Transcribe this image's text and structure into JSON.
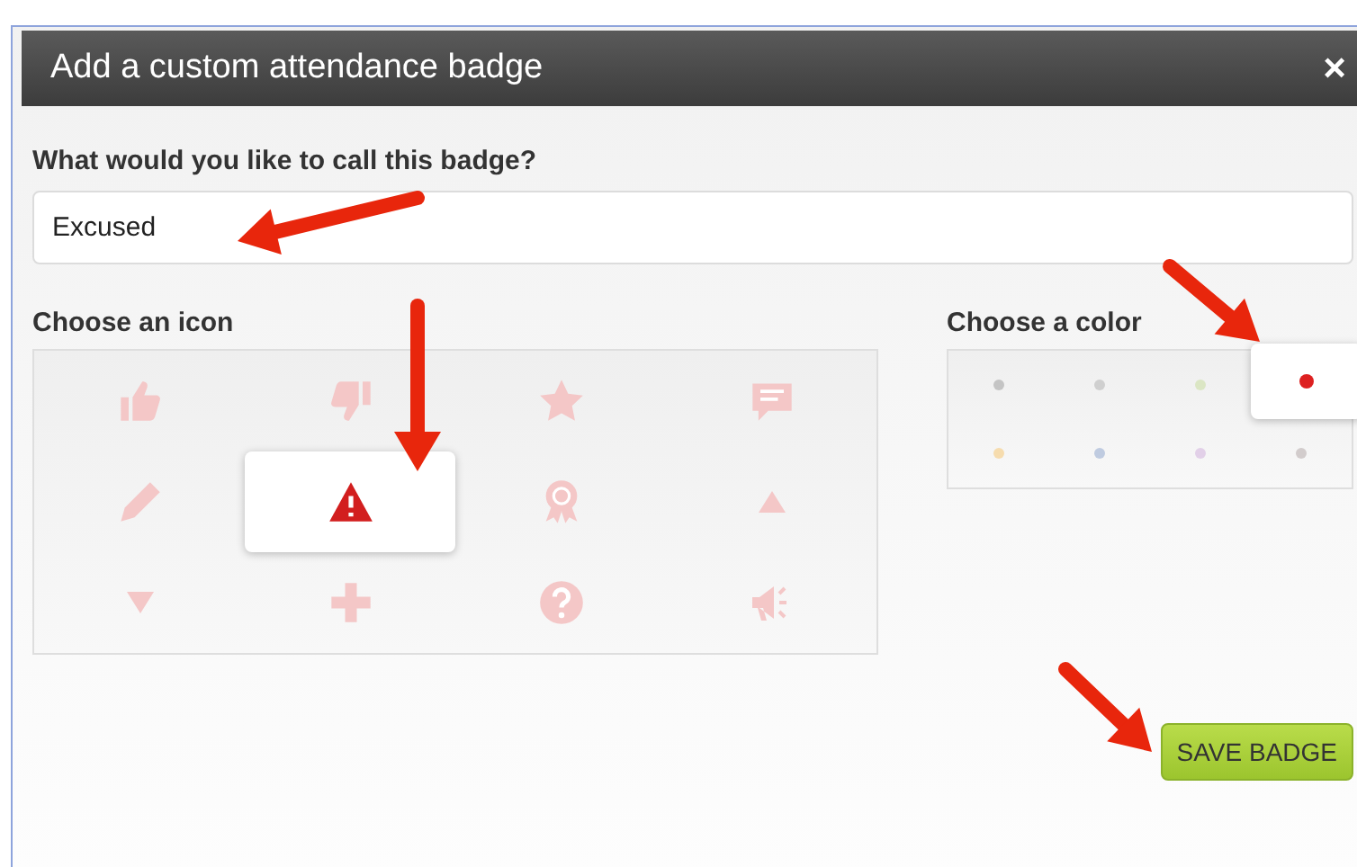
{
  "dialog": {
    "title": "Add a custom attendance badge",
    "close": "×"
  },
  "name_field": {
    "label": "What would you like to call this badge?",
    "value": "Excused"
  },
  "icon_picker": {
    "label": "Choose an icon",
    "icons": [
      {
        "kind": "thumbs-up",
        "selected": false
      },
      {
        "kind": "thumbs-down",
        "selected": false
      },
      {
        "kind": "star",
        "selected": false
      },
      {
        "kind": "comment",
        "selected": false
      },
      {
        "kind": "pencil",
        "selected": false
      },
      {
        "kind": "warning",
        "selected": true
      },
      {
        "kind": "award",
        "selected": false
      },
      {
        "kind": "arrow-up",
        "selected": false
      },
      {
        "kind": "arrow-down",
        "selected": false
      },
      {
        "kind": "plus",
        "selected": false
      },
      {
        "kind": "question",
        "selected": false
      },
      {
        "kind": "megaphone",
        "selected": false
      }
    ]
  },
  "color_picker": {
    "label": "Choose a color",
    "colors": [
      {
        "color": "#c4c4c4",
        "selected": false
      },
      {
        "color": "#cfcfcf",
        "selected": false
      },
      {
        "color": "#dbe6c4",
        "selected": false
      },
      {
        "color": "#dd2020",
        "selected": true
      },
      {
        "color": "#f6dcae",
        "selected": false
      },
      {
        "color": "#bfcbe0",
        "selected": false
      },
      {
        "color": "#e2d0e8",
        "selected": false
      },
      {
        "color": "#d2cccc",
        "selected": false
      }
    ]
  },
  "save_button": "SAVE BADGE"
}
